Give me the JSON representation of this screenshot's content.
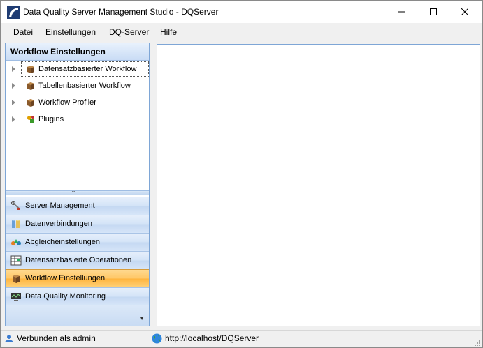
{
  "window": {
    "title": "Data Quality Server Management Studio - DQServer"
  },
  "menu": [
    "Datei",
    "Einstellungen",
    "DQ-Server",
    "Hilfe"
  ],
  "left_panel": {
    "header": "Workflow Einstellungen",
    "tree_items": [
      {
        "label": "Datensatzbasierter Workflow",
        "icon": "box-icon",
        "focused": true
      },
      {
        "label": "Tabellenbasierter Workflow",
        "icon": "box-icon"
      },
      {
        "label": "Workflow Profiler",
        "icon": "box-icon"
      },
      {
        "label": "Plugins",
        "icon": "plugin-icon"
      }
    ],
    "nav_buttons": [
      {
        "label": "Server Management",
        "icon": "wrench-icon"
      },
      {
        "label": "Datenverbindungen",
        "icon": "database-icon"
      },
      {
        "label": "Abgleicheinstellungen",
        "icon": "shapes-icon"
      },
      {
        "label": "Datensatzbasierte Operationen",
        "icon": "table-icon"
      },
      {
        "label": "Workflow Einstellungen",
        "icon": "box-icon",
        "selected": true
      },
      {
        "label": "Data Quality Monitoring",
        "icon": "monitor-icon"
      }
    ]
  },
  "status": {
    "connection": "Verbunden als admin",
    "url": "http://localhost/DQServer"
  },
  "colors": {
    "accent": "#7ea6d6",
    "selected": "#ffc766"
  }
}
